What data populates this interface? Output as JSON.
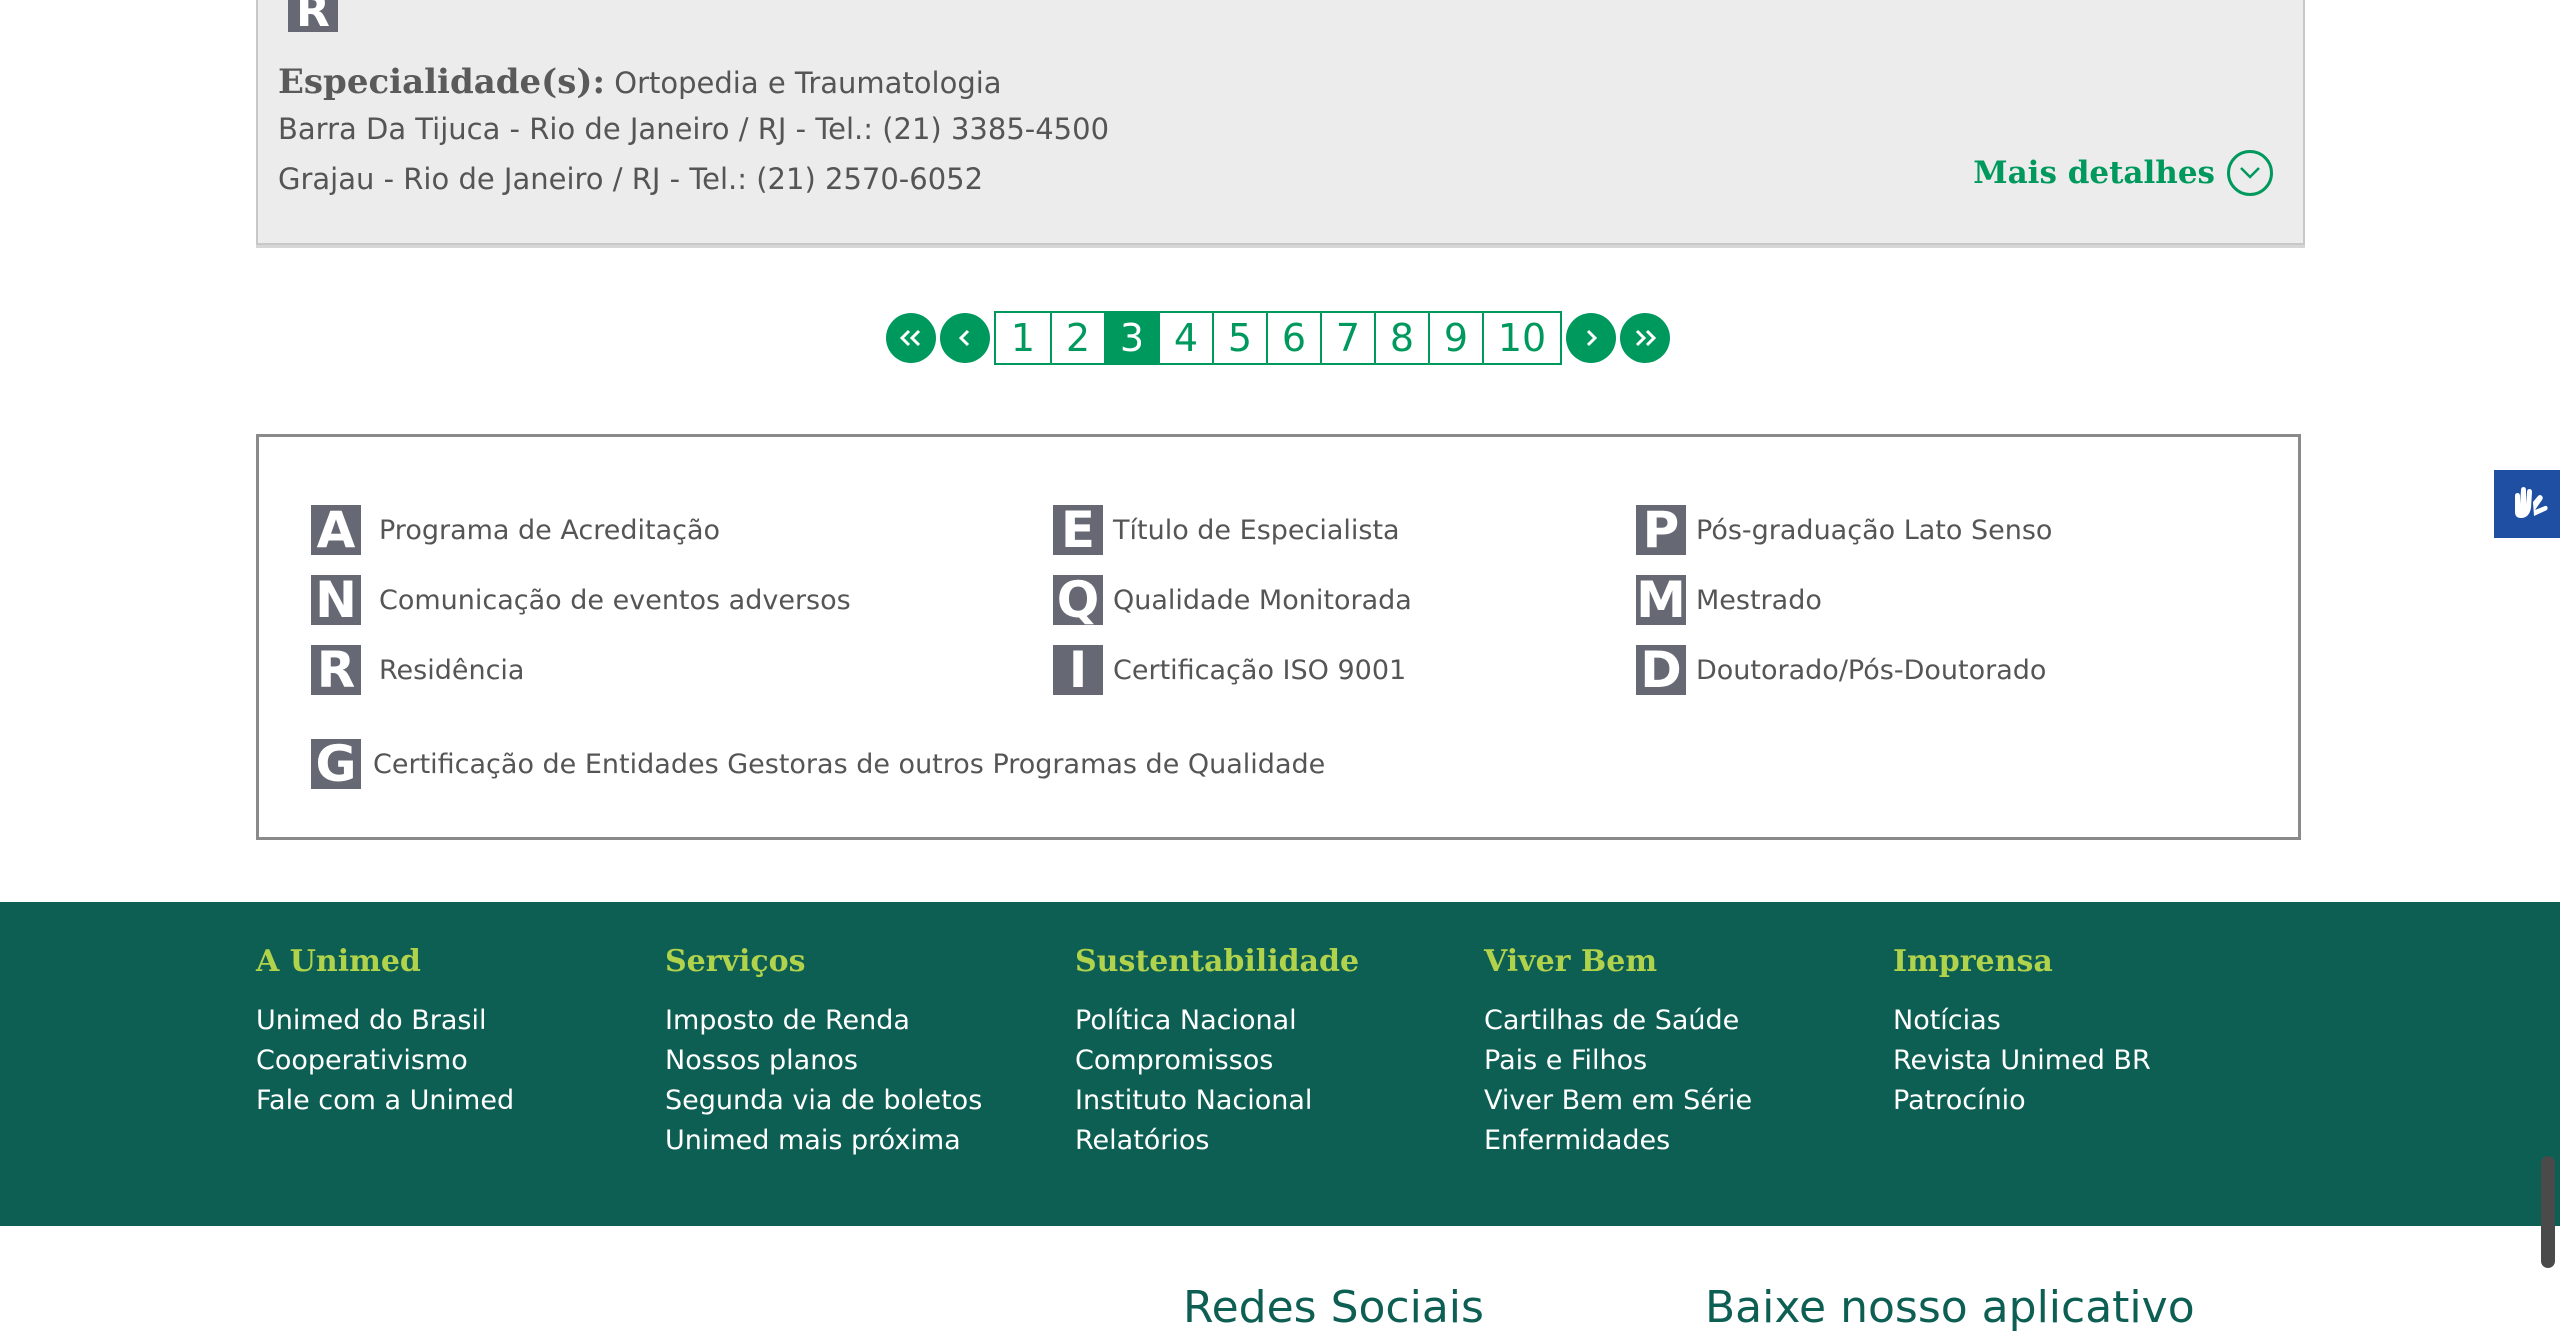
{
  "result": {
    "badge_letter": "R",
    "specialty_label": "Especialidade(s):",
    "specialty_value": " Ortopedia e Traumatologia",
    "address1": "Barra Da Tijuca - Rio de Janeiro / RJ - Tel.: (21) 3385-4500",
    "address2": "Grajau - Rio de Janeiro / RJ - Tel.: (21) 2570-6052",
    "details_label": "Mais detalhes"
  },
  "pagination": {
    "pages": [
      "1",
      "2",
      "3",
      "4",
      "5",
      "6",
      "7",
      "8",
      "9",
      "10"
    ],
    "current": "3"
  },
  "legend": {
    "items": [
      {
        "letter": "A",
        "label": "Programa de Acreditação"
      },
      {
        "letter": "E",
        "label": "Título de Especialista"
      },
      {
        "letter": "P",
        "label": "Pós-graduação Lato Senso"
      },
      {
        "letter": "N",
        "label": "Comunicação de eventos adversos"
      },
      {
        "letter": "Q",
        "label": "Qualidade Monitorada"
      },
      {
        "letter": "M",
        "label": "Mestrado"
      },
      {
        "letter": "R",
        "label": "Residência"
      },
      {
        "letter": "I",
        "label": "Certificação ISO 9001"
      },
      {
        "letter": "D",
        "label": "Doutorado/Pós-Doutorado"
      },
      {
        "letter": "G",
        "label": "Certificação de Entidades Gestoras de outros Programas de Qualidade"
      }
    ]
  },
  "footer": {
    "columns": [
      {
        "title": "A Unimed",
        "links": [
          "Unimed do Brasil",
          "Cooperativismo",
          "Fale com a Unimed"
        ]
      },
      {
        "title": "Serviços",
        "links": [
          "Imposto de Renda",
          "Nossos planos",
          "Segunda via de boletos",
          "Unimed mais próxima"
        ]
      },
      {
        "title": "Sustentabilidade",
        "links": [
          "Política Nacional",
          "Compromissos",
          "Instituto Nacional",
          "Relatórios"
        ]
      },
      {
        "title": "Viver Bem",
        "links": [
          "Cartilhas de Saúde",
          "Pais e Filhos",
          "Viver Bem em Série",
          "Enfermidades"
        ]
      },
      {
        "title": "Imprensa",
        "links": [
          "Notícias",
          "Revista Unimed BR",
          "Patrocínio"
        ]
      }
    ]
  },
  "bottom": {
    "social_title": "Redes Sociais",
    "app_title": "Baixe nosso aplicativo"
  },
  "colors": {
    "brand_green": "#00995d",
    "footer_bg": "#0e5f53",
    "footer_heading": "#b1d34b",
    "badge_gray": "#666873",
    "accessibility_blue": "#1e4fa3"
  }
}
